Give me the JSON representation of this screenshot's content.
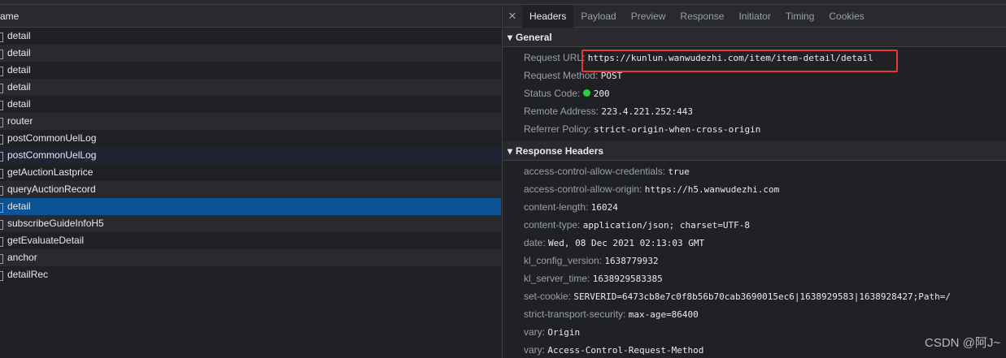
{
  "colors": {
    "selected": "#0b5394",
    "status_ok": "#2ecc40",
    "highlight": "#e53935"
  },
  "left": {
    "header": "ame",
    "rows": [
      "detail",
      "detail",
      "detail",
      "detail",
      "detail",
      "router",
      "postCommonUelLog",
      "postCommonUelLog",
      "getAuctionLastprice",
      "queryAuctionRecord",
      "detail",
      "subscribeGuideInfoH5",
      "getEvaluateDetail",
      "anchor",
      "detailRec"
    ]
  },
  "tabs": [
    "Headers",
    "Payload",
    "Preview",
    "Response",
    "Initiator",
    "Timing",
    "Cookies"
  ],
  "general": {
    "title": "General",
    "items": [
      {
        "k": "Request URL:",
        "v": "https://kunlun.wanwudezhi.com/item/item-detail/detail"
      },
      {
        "k": "Request Method:",
        "v": "POST"
      },
      {
        "k": "Status Code:",
        "v": "200"
      },
      {
        "k": "Remote Address:",
        "v": "223.4.221.252:443"
      },
      {
        "k": "Referrer Policy:",
        "v": "strict-origin-when-cross-origin"
      }
    ]
  },
  "response": {
    "title": "Response Headers",
    "items": [
      {
        "k": "access-control-allow-credentials:",
        "v": "true"
      },
      {
        "k": "access-control-allow-origin:",
        "v": "https://h5.wanwudezhi.com"
      },
      {
        "k": "content-length:",
        "v": "16024"
      },
      {
        "k": "content-type:",
        "v": "application/json; charset=UTF-8"
      },
      {
        "k": "date:",
        "v": "Wed, 08 Dec 2021 02:13:03 GMT"
      },
      {
        "k": "kl_config_version:",
        "v": "1638779932"
      },
      {
        "k": "kl_server_time:",
        "v": "1638929583385"
      },
      {
        "k": "set-cookie:",
        "v": "SERVERID=6473cb8e7c0f8b56b70cab3690015ec6|1638929583|1638928427;Path=/"
      },
      {
        "k": "strict-transport-security:",
        "v": "max-age=86400"
      },
      {
        "k": "vary:",
        "v": "Origin"
      },
      {
        "k": "vary:",
        "v": "Access-Control-Request-Method"
      }
    ]
  },
  "watermark": "CSDN @阿J~"
}
